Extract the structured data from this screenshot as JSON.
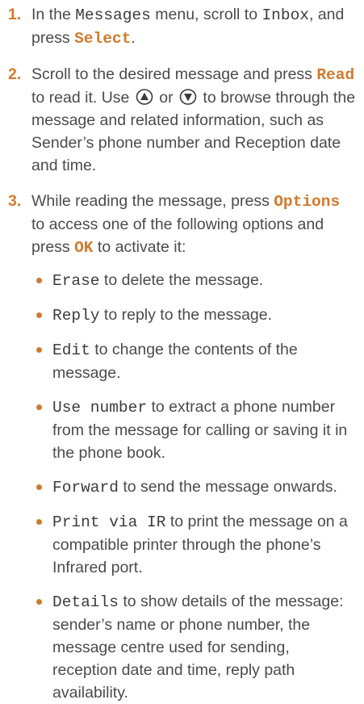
{
  "steps": [
    {
      "number": "1.",
      "parts": [
        "In the ",
        "Messages",
        " menu, scroll to ",
        "Inbox",
        ", and press ",
        "Select",
        "."
      ]
    },
    {
      "number": "2.",
      "parts": [
        "Scroll to the desired message and press ",
        "Read",
        " to read it. Use ",
        " or ",
        " to browse through the message and related information, such as Sender’s phone number and Reception date and time."
      ]
    },
    {
      "number": "3.",
      "parts": [
        "While reading the message, press ",
        "Options",
        " to access one of the following options and press ",
        "OK",
        " to activate it:"
      ]
    }
  ],
  "options": [
    {
      "name": "Erase",
      "desc": " to delete the message."
    },
    {
      "name": "Reply",
      "desc": " to reply to the message."
    },
    {
      "name": "Edit",
      "desc": " to change the contents of the message."
    },
    {
      "name": "Use number",
      "desc": " to extract a phone number from the message for calling or saving it in the phone book."
    },
    {
      "name": "Forward",
      "desc": " to send the message onwards."
    },
    {
      "name": "Print via IR",
      "desc": " to print the message on a compatible printer through the phone’s Infrared port."
    },
    {
      "name": "Details",
      "desc": " to show details of the message: sender’s name or phone number, the message centre used for sending, reception date and time, reply path availability."
    }
  ],
  "icons": {
    "up": "scroll-up-key-icon",
    "down": "scroll-down-key-icon"
  },
  "colors": {
    "accent": "#d07a2e",
    "text": "#4b4b4b"
  }
}
